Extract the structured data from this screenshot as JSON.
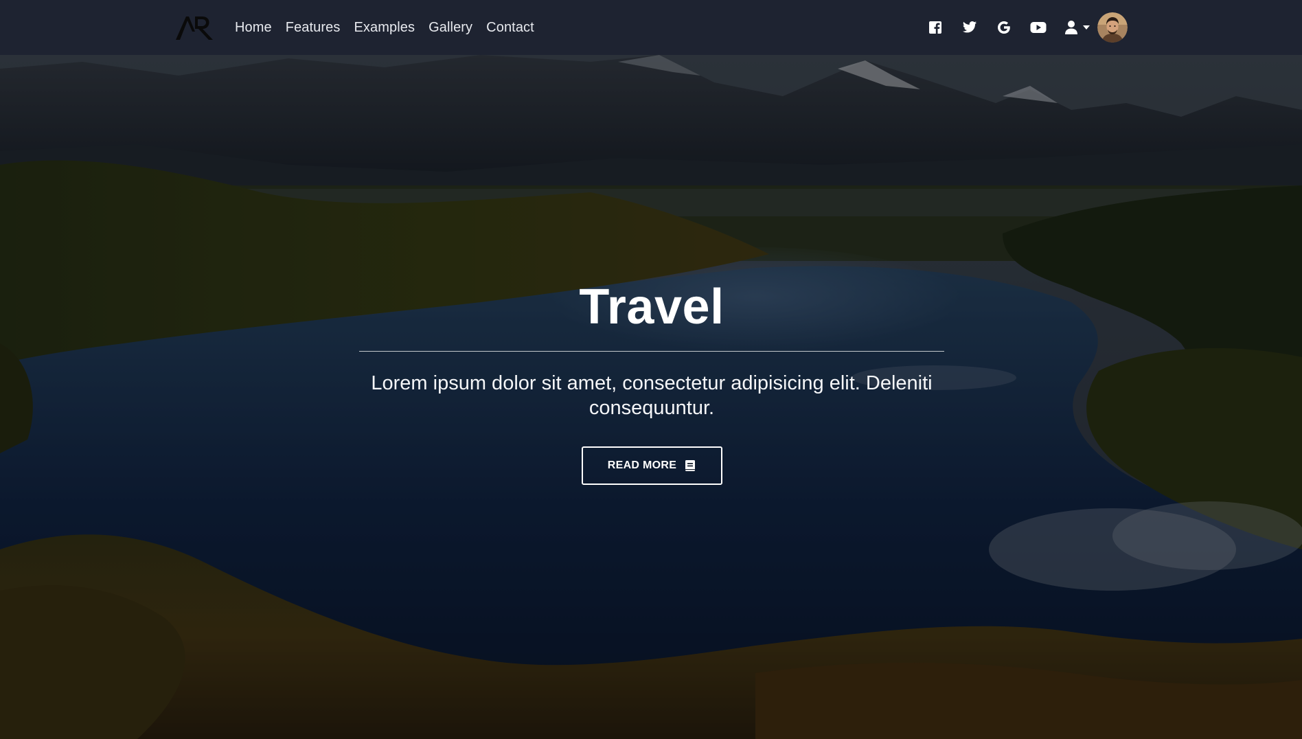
{
  "nav": {
    "links": [
      {
        "label": "Home"
      },
      {
        "label": "Features"
      },
      {
        "label": "Examples"
      },
      {
        "label": "Gallery"
      },
      {
        "label": "Contact"
      }
    ],
    "icons": [
      "facebook-icon",
      "twitter-icon",
      "google-icon",
      "youtube-icon",
      "user-icon",
      "caret-down-icon"
    ]
  },
  "hero": {
    "title": "Travel",
    "text": "Lorem ipsum dolor sit amet, consectetur adipisicing elit. Deleniti consequuntur.",
    "button_label": "READ MORE",
    "button_icon": "book-icon"
  },
  "colors": {
    "navbar_bg": "#1e2331",
    "nav_text": "#e8eaef",
    "hero_text": "#ffffff"
  }
}
